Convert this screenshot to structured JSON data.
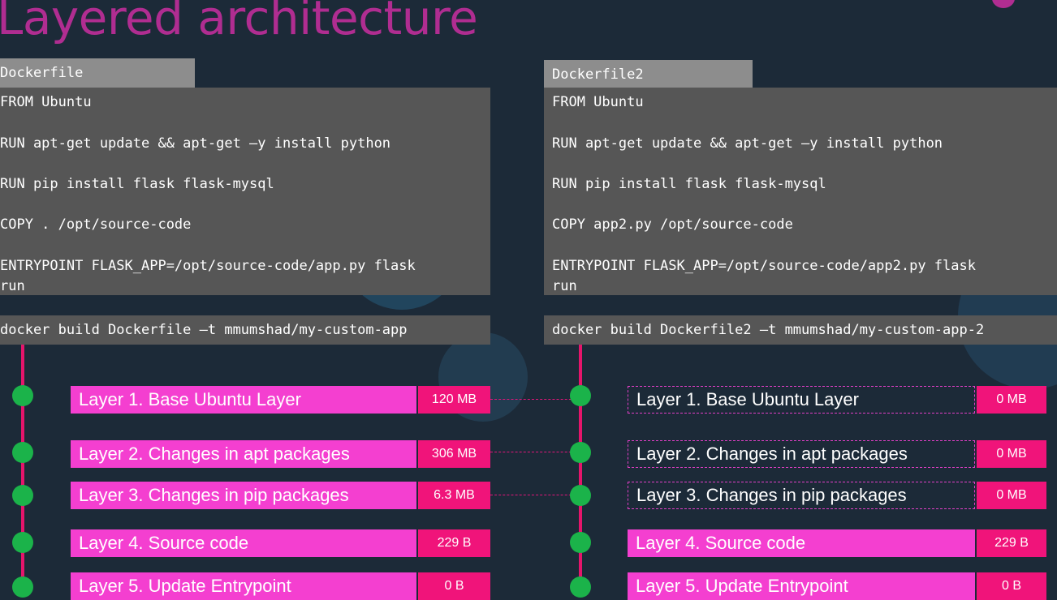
{
  "title": "Layered architecture",
  "colors": {
    "background": "#1c2a38",
    "title": "#b02d91",
    "layer": "#f43fd0",
    "size": "#f0147a",
    "timeline": "#e5156b",
    "node": "#1bb34a",
    "code_bg": "#565656",
    "tab_bg": "#8d8d8d"
  },
  "left": {
    "file_tab": "Dockerfile",
    "code": [
      "FROM Ubuntu",
      "RUN apt-get update && apt-get –y install python",
      "RUN pip install flask flask-mysql",
      "COPY . /opt/source-code",
      "ENTRYPOINT FLASK_APP=/opt/source-code/app.py flask",
      "run"
    ],
    "command": "docker build Dockerfile –t mmumshad/my-custom-app",
    "layers": [
      {
        "label": "Layer 1. Base Ubuntu Layer",
        "size": "120 MB"
      },
      {
        "label": "Layer 2. Changes in apt packages",
        "size": "306 MB"
      },
      {
        "label": "Layer 3. Changes in pip packages",
        "size": "6.3 MB"
      },
      {
        "label": "Layer 4. Source code",
        "size": "229 B"
      },
      {
        "label": "Layer 5. Update Entrypoint",
        "size": "0 B"
      }
    ]
  },
  "right": {
    "file_tab": "Dockerfile2",
    "code": [
      "FROM Ubuntu",
      "RUN apt-get update && apt-get –y install python",
      "RUN pip install flask flask-mysql",
      "COPY app2.py /opt/source-code",
      "ENTRYPOINT FLASK_APP=/opt/source-code/app2.py flask",
      "run"
    ],
    "command": "docker build Dockerfile2 –t mmumshad/my-custom-app-2",
    "layers": [
      {
        "label": "Layer 1. Base Ubuntu Layer",
        "size": "0 MB",
        "cached": true
      },
      {
        "label": "Layer 2. Changes in apt packages",
        "size": "0 MB",
        "cached": true
      },
      {
        "label": "Layer 3. Changes in pip packages",
        "size": "0 MB",
        "cached": true
      },
      {
        "label": "Layer 4. Source code",
        "size": "229 B",
        "cached": false
      },
      {
        "label": "Layer 5. Update Entrypoint",
        "size": "0 B",
        "cached": false
      }
    ]
  }
}
